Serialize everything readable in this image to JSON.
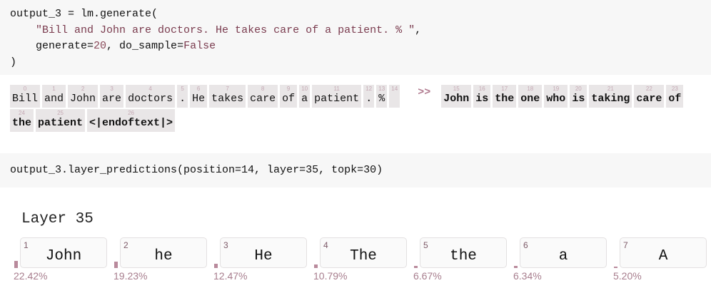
{
  "cell1": {
    "line1": "output_3 = lm.generate(",
    "line2_indent": "    ",
    "line2_string": "\"Bill and John are doctors. He takes care of a patient. % \"",
    "line2_end": ",",
    "line3_a": "    generate=",
    "line3_num": "20",
    "line3_b": ", do_sample=",
    "line3_kw": "False",
    "line4": ")"
  },
  "tokens": [
    {
      "i": "0",
      "t": "Bill"
    },
    {
      "i": "1",
      "t": "and"
    },
    {
      "i": "2",
      "t": "John"
    },
    {
      "i": "3",
      "t": "are"
    },
    {
      "i": "4",
      "t": "doctors"
    },
    {
      "i": "5",
      "t": "."
    },
    {
      "i": "6",
      "t": "He"
    },
    {
      "i": "7",
      "t": "takes"
    },
    {
      "i": "8",
      "t": "care"
    },
    {
      "i": "9",
      "t": "of"
    },
    {
      "i": "10",
      "t": "a"
    },
    {
      "i": "11",
      "t": "patient"
    },
    {
      "i": "12",
      "t": "."
    },
    {
      "i": "13",
      "t": "%"
    },
    {
      "i": "14",
      "t": " "
    }
  ],
  "separator": ">>",
  "generated": [
    {
      "i": "15",
      "t": "John"
    },
    {
      "i": "16",
      "t": "is"
    },
    {
      "i": "17",
      "t": "the"
    },
    {
      "i": "18",
      "t": "one"
    },
    {
      "i": "19",
      "t": "who"
    },
    {
      "i": "20",
      "t": "is"
    },
    {
      "i": "21",
      "t": "taking"
    },
    {
      "i": "22",
      "t": "care"
    },
    {
      "i": "23",
      "t": "of"
    },
    {
      "i": "24",
      "t": "the"
    },
    {
      "i": "25",
      "t": "patient"
    },
    {
      "i": "26",
      "t": "<|endoftext|>"
    }
  ],
  "cell2": {
    "code": "output_3.layer_predictions(position=14, layer=35, topk=30)"
  },
  "layer_title": "Layer 35",
  "bar_color": "#b98a9c",
  "predictions": [
    {
      "rank": "1",
      "token": "John",
      "pct": "22.42%",
      "p": 22.42
    },
    {
      "rank": "2",
      "token": "he",
      "pct": "19.23%",
      "p": 19.23
    },
    {
      "rank": "3",
      "token": "He",
      "pct": "12.47%",
      "p": 12.47
    },
    {
      "rank": "4",
      "token": "The",
      "pct": "10.79%",
      "p": 10.79
    },
    {
      "rank": "5",
      "token": "the",
      "pct": "6.67%",
      "p": 6.67
    },
    {
      "rank": "6",
      "token": "a",
      "pct": "6.34%",
      "p": 6.34
    },
    {
      "rank": "7",
      "token": "A",
      "pct": "5.20%",
      "p": 5.2
    }
  ]
}
